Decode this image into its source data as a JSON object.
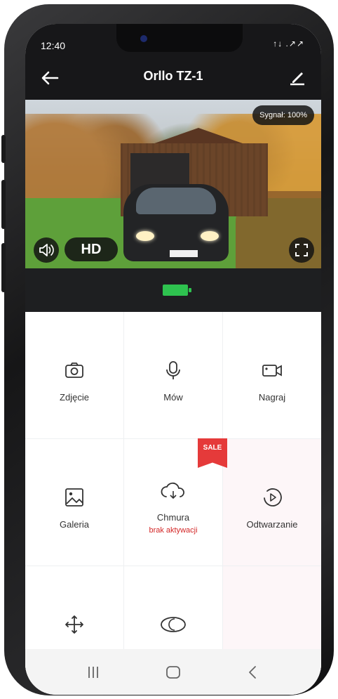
{
  "status_bar": {
    "time": "12:40",
    "signal_text": "↑↓ .↗↗"
  },
  "header": {
    "title": "Orllo TZ-1",
    "back_icon": "arrow-left-icon",
    "edit_icon": "pencil-icon"
  },
  "video": {
    "signal_label": "Sygnał: 100%",
    "quality_label": "HD",
    "sound_icon": "speaker-icon",
    "fullscreen_icon": "expand-icon"
  },
  "battery": {
    "level": 1.0,
    "color": "#2ec24f"
  },
  "grid": {
    "items": [
      {
        "label": "Zdjęcie",
        "icon": "camera-icon"
      },
      {
        "label": "Mów",
        "icon": "microphone-icon"
      },
      {
        "label": "Nagraj",
        "icon": "video-camera-icon"
      },
      {
        "label": "Galeria",
        "icon": "image-icon"
      },
      {
        "label": "Chmura",
        "sublabel": "brak aktywacji",
        "icon": "cloud-sync-icon",
        "badge": "SALE"
      },
      {
        "label": "Odtwarzanie",
        "icon": "playback-icon"
      },
      {
        "label": "",
        "icon": "move-arrows-icon"
      },
      {
        "label": "",
        "icon": "night-mode-icon"
      }
    ]
  },
  "nav": {
    "recent_icon": "recent-apps-icon",
    "home_icon": "home-icon",
    "back_icon": "back-chevron-icon"
  },
  "colors": {
    "accent_red": "#e53a3a",
    "dark_bg": "#171719",
    "battery_green": "#2ec24f"
  }
}
